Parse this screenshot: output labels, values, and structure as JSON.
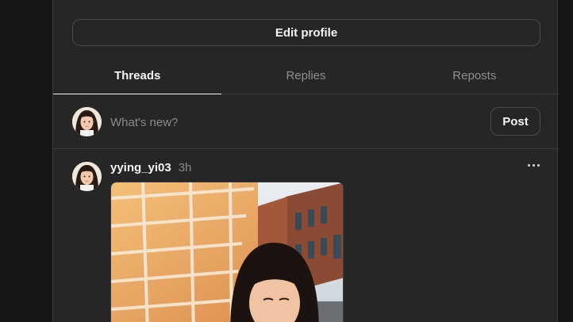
{
  "profile": {
    "edit_label": "Edit profile"
  },
  "tabs": [
    {
      "label": "Threads",
      "active": true
    },
    {
      "label": "Replies",
      "active": false
    },
    {
      "label": "Reposts",
      "active": false
    }
  ],
  "composer": {
    "placeholder": "What's new?",
    "post_label": "Post"
  },
  "thread": {
    "username": "yying_yi03",
    "time": "3h",
    "more_icon": "more-horizontal-icon"
  },
  "colors": {
    "panel": "#262626",
    "background": "#101010",
    "text": "#f3f5f7",
    "muted": "#8f8f8f",
    "divider": "#3d3d3d"
  }
}
